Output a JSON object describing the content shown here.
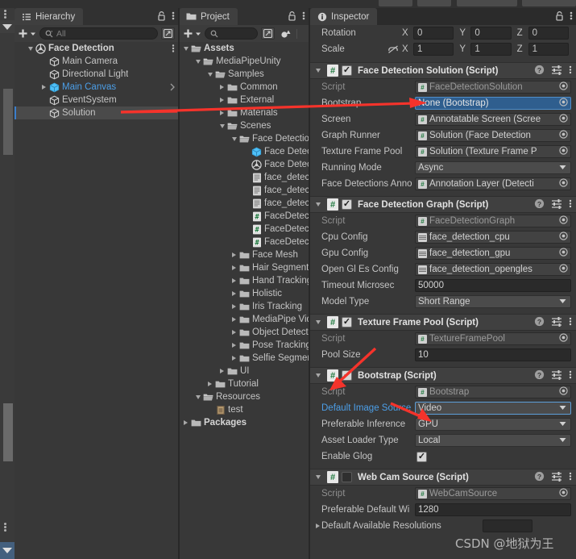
{
  "hierarchy": {
    "tab_label": "Hierarchy",
    "tab_icon": "hierarchy-icon",
    "add_label": "+",
    "search_placeholder": "All",
    "items": [
      {
        "label": "Face Detection",
        "indent": 0,
        "arrow": "down",
        "icon": "scene-icon",
        "style": "bold",
        "menu": true
      },
      {
        "label": "Main Camera",
        "indent": 1,
        "arrow": "none",
        "icon": "cube-icon",
        "style": "normal"
      },
      {
        "label": "Directional Light",
        "indent": 1,
        "arrow": "none",
        "icon": "cube-icon",
        "style": "normal"
      },
      {
        "label": "Main Canvas",
        "indent": 1,
        "arrow": "right",
        "icon": "prefab-icon",
        "style": "blue",
        "chevron": true
      },
      {
        "label": "EventSystem",
        "indent": 1,
        "arrow": "none",
        "icon": "cube-icon",
        "style": "normal"
      },
      {
        "label": "Solution",
        "indent": 1,
        "arrow": "none",
        "icon": "cube-icon",
        "style": "normal",
        "selected": true
      }
    ]
  },
  "project": {
    "tab_label": "Project",
    "tab_icon": "folder-icon",
    "add_label": "+",
    "search_placeholder": "",
    "items": [
      {
        "label": "Assets",
        "indent": 0,
        "arrow": "down",
        "icon": "folder-open-icon",
        "style": "bold"
      },
      {
        "label": "MediaPipeUnity",
        "indent": 1,
        "arrow": "down",
        "icon": "folder-open-icon",
        "style": "normal"
      },
      {
        "label": "Samples",
        "indent": 2,
        "arrow": "down",
        "icon": "folder-open-icon",
        "style": "normal"
      },
      {
        "label": "Common",
        "indent": 3,
        "arrow": "right",
        "icon": "folder-icon",
        "style": "normal"
      },
      {
        "label": "External",
        "indent": 3,
        "arrow": "right",
        "icon": "folder-icon",
        "style": "normal"
      },
      {
        "label": "Materials",
        "indent": 3,
        "arrow": "right",
        "icon": "folder-icon",
        "style": "normal"
      },
      {
        "label": "Scenes",
        "indent": 3,
        "arrow": "down",
        "icon": "folder-open-icon",
        "style": "normal"
      },
      {
        "label": "Face Detection",
        "indent": 4,
        "arrow": "down",
        "icon": "folder-open-icon",
        "style": "normal"
      },
      {
        "label": "Face Detection",
        "indent": 5,
        "arrow": "none",
        "icon": "prefab-icon",
        "style": "normal"
      },
      {
        "label": "Face Detection",
        "indent": 5,
        "arrow": "none",
        "icon": "scene-icon",
        "style": "normal"
      },
      {
        "label": "face_detection_cpu",
        "indent": 5,
        "arrow": "none",
        "icon": "text-icon",
        "style": "normal"
      },
      {
        "label": "face_detection_gpu",
        "indent": 5,
        "arrow": "none",
        "icon": "text-icon",
        "style": "normal"
      },
      {
        "label": "face_detection_open",
        "indent": 5,
        "arrow": "none",
        "icon": "text-icon",
        "style": "normal"
      },
      {
        "label": "FaceDetectionGraph",
        "indent": 5,
        "arrow": "none",
        "icon": "cs-icon",
        "style": "normal"
      },
      {
        "label": "FaceDetectionSolut",
        "indent": 5,
        "arrow": "none",
        "icon": "cs-icon",
        "style": "normal"
      },
      {
        "label": "FaceDetectionConfi",
        "indent": 5,
        "arrow": "none",
        "icon": "cs-icon",
        "style": "normal"
      },
      {
        "label": "Face Mesh",
        "indent": 4,
        "arrow": "right",
        "icon": "folder-icon",
        "style": "normal"
      },
      {
        "label": "Hair Segmentation",
        "indent": 4,
        "arrow": "right",
        "icon": "folder-icon",
        "style": "normal"
      },
      {
        "label": "Hand Tracking",
        "indent": 4,
        "arrow": "right",
        "icon": "folder-icon",
        "style": "normal"
      },
      {
        "label": "Holistic",
        "indent": 4,
        "arrow": "right",
        "icon": "folder-icon",
        "style": "normal"
      },
      {
        "label": "Iris Tracking",
        "indent": 4,
        "arrow": "right",
        "icon": "folder-icon",
        "style": "normal"
      },
      {
        "label": "MediaPipe Video",
        "indent": 4,
        "arrow": "right",
        "icon": "folder-icon",
        "style": "normal"
      },
      {
        "label": "Object Detection",
        "indent": 4,
        "arrow": "right",
        "icon": "folder-icon",
        "style": "normal"
      },
      {
        "label": "Pose Tracking",
        "indent": 4,
        "arrow": "right",
        "icon": "folder-icon",
        "style": "normal"
      },
      {
        "label": "Selfie Segmentation",
        "indent": 4,
        "arrow": "right",
        "icon": "folder-icon",
        "style": "normal"
      },
      {
        "label": "UI",
        "indent": 3,
        "arrow": "right",
        "icon": "folder-icon",
        "style": "normal"
      },
      {
        "label": "Tutorial",
        "indent": 2,
        "arrow": "right",
        "icon": "folder-icon",
        "style": "normal"
      },
      {
        "label": "Resources",
        "indent": 1,
        "arrow": "down",
        "icon": "folder-open-icon",
        "style": "normal"
      },
      {
        "label": "test",
        "indent": 2,
        "arrow": "none",
        "icon": "image-icon",
        "style": "normal"
      },
      {
        "label": "Packages",
        "indent": 0,
        "arrow": "right",
        "icon": "folder-icon",
        "style": "bold"
      }
    ]
  },
  "inspector": {
    "tab_label": "Inspector",
    "tab_icon": "info-icon",
    "transform": {
      "rows": [
        {
          "label": "Rotation",
          "lock": false,
          "axes": [
            {
              "axis": "X",
              "value": "0"
            },
            {
              "axis": "Y",
              "value": "0"
            },
            {
              "axis": "Z",
              "value": "0"
            }
          ]
        },
        {
          "label": "Scale",
          "lock": true,
          "axes": [
            {
              "axis": "X",
              "value": "1"
            },
            {
              "axis": "Y",
              "value": "1"
            },
            {
              "axis": "Z",
              "value": "1"
            }
          ]
        }
      ]
    },
    "components": [
      {
        "title": "Face Detection Solution (Script)",
        "enabled": true,
        "expanded": true,
        "rows": [
          {
            "label": "Script",
            "type": "object",
            "value": "FaceDetectionSolution",
            "badge": "cs",
            "disabled": true
          },
          {
            "label": "Bootstrap",
            "type": "object",
            "value": "None (Bootstrap)",
            "badge": "none",
            "selected": true
          },
          {
            "label": "Screen",
            "type": "object",
            "value": "Annotatable Screen (Scree",
            "badge": "cs"
          },
          {
            "label": "Graph Runner",
            "type": "object",
            "value": "Solution (Face Detection ",
            "badge": "cs"
          },
          {
            "label": "Texture Frame Pool",
            "type": "object",
            "value": "Solution (Texture Frame P",
            "badge": "cs"
          },
          {
            "label": "Running Mode",
            "type": "popup",
            "value": "Async"
          },
          {
            "label": "Face Detections Anno",
            "type": "object",
            "value": "Annotation Layer (Detecti",
            "badge": "cs"
          }
        ]
      },
      {
        "title": "Face Detection Graph (Script)",
        "enabled": true,
        "expanded": true,
        "rows": [
          {
            "label": "Script",
            "type": "object",
            "value": "FaceDetectionGraph",
            "badge": "cs",
            "disabled": true
          },
          {
            "label": "Cpu Config",
            "type": "object",
            "value": "face_detection_cpu",
            "badge": "txt"
          },
          {
            "label": "Gpu Config",
            "type": "object",
            "value": "face_detection_gpu",
            "badge": "txt"
          },
          {
            "label": "Open Gl Es Config",
            "type": "object",
            "value": "face_detection_opengles",
            "badge": "txt"
          },
          {
            "label": "Timeout Microsec",
            "type": "text",
            "value": "50000"
          },
          {
            "label": "Model Type",
            "type": "popup",
            "value": "Short Range"
          }
        ]
      },
      {
        "title": "Texture Frame Pool (Script)",
        "enabled": true,
        "expanded": true,
        "rows": [
          {
            "label": "Script",
            "type": "object",
            "value": "TextureFramePool",
            "badge": "cs",
            "disabled": true
          },
          {
            "label": "Pool Size",
            "type": "text",
            "value": "10"
          }
        ]
      },
      {
        "title": "Bootstrap (Script)",
        "enabled": true,
        "expanded": true,
        "rows": [
          {
            "label": "Script",
            "type": "object",
            "value": "Bootstrap",
            "badge": "cs",
            "disabled": true
          },
          {
            "label": "Default Image Source",
            "type": "popup",
            "value": "Video",
            "label_style": "blue",
            "highlight": true
          },
          {
            "label": "Preferable Inference",
            "type": "popup",
            "value": "GPU"
          },
          {
            "label": "Asset Loader Type",
            "type": "popup",
            "value": "Local"
          },
          {
            "label": "Enable Glog",
            "type": "checkbox",
            "value": true
          }
        ]
      },
      {
        "title": "Web Cam Source (Script)",
        "enabled": false,
        "expanded": true,
        "rows": [
          {
            "label": "Script",
            "type": "object",
            "value": "WebCamSource",
            "badge": "cs",
            "disabled": true
          },
          {
            "label": "Preferable Default Wi",
            "type": "text",
            "value": "1280"
          },
          {
            "label": "Default Available Resolutions",
            "type": "foldout",
            "value": ""
          }
        ]
      }
    ]
  },
  "watermark": {
    "text": "CSDN @地狱为王"
  },
  "colors": {
    "accent_blue": "#3b7ecb",
    "selection_blue": "#2f5e8e",
    "annotation_red": "#f5332b",
    "panel_bg": "#383838",
    "header_bg": "#404040"
  }
}
